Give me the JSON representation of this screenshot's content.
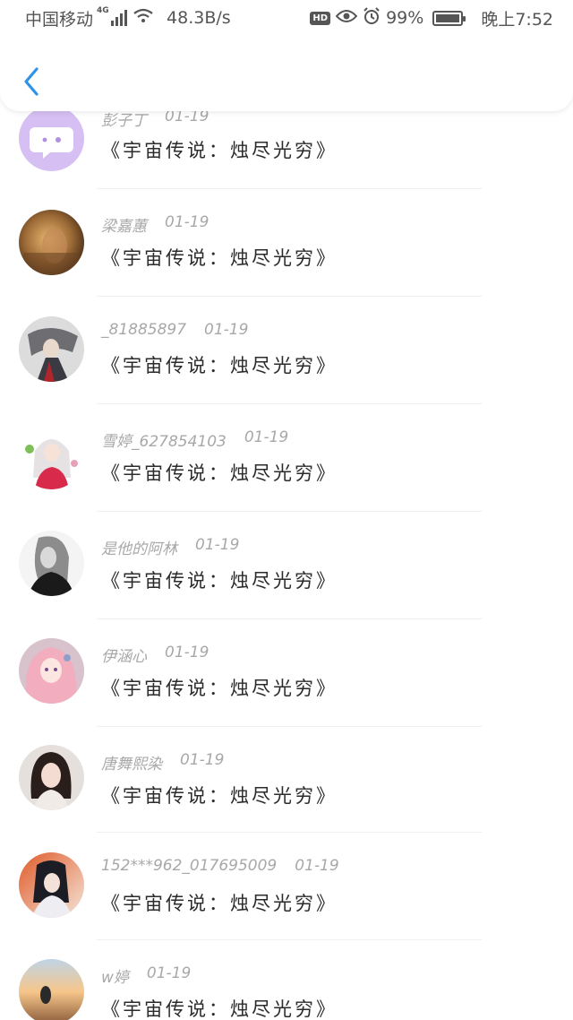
{
  "status_bar": {
    "carrier": "中国移动",
    "network": "4G",
    "speed": "48.3B/s",
    "hd": "HD",
    "battery": "99%",
    "battery_level": 0.99,
    "time": "晚上7:52"
  },
  "header": {
    "back_icon": "chevron-left-icon",
    "accent": "#2e93e8"
  },
  "items": [
    {
      "name": "彭子丁",
      "date": "01-19",
      "title": "《宇宙传说：烛尽光穷》",
      "avatar": "chat-bubble-default"
    },
    {
      "name": "梁嘉蕙",
      "date": "01-19",
      "title": "《宇宙传说：烛尽光穷》",
      "avatar": "warm-painting"
    },
    {
      "name": "_81885897",
      "date": "01-19",
      "title": "《宇宙传说：烛尽光穷》",
      "avatar": "ink-warrior"
    },
    {
      "name": "雪婷_627854103",
      "date": "01-19",
      "title": "《宇宙传说：烛尽光穷》",
      "avatar": "anime-girl-white-hair"
    },
    {
      "name": "是他的阿林",
      "date": "01-19",
      "title": "《宇宙传说：烛尽光穷》",
      "avatar": "grayscale-portrait"
    },
    {
      "name": "伊涵心",
      "date": "01-19",
      "title": "《宇宙传说：烛尽光穷》",
      "avatar": "anime-girl-pink-hair"
    },
    {
      "name": "唐舞熙染",
      "date": "01-19",
      "title": "《宇宙传说：烛尽光穷》",
      "avatar": "girl-selfie"
    },
    {
      "name": "152***962_017695009",
      "date": "01-19",
      "title": "《宇宙传说：烛尽光穷》",
      "avatar": "anime-swordsman"
    },
    {
      "name": "w婷",
      "date": "01-19",
      "title": "《宇宙传说：烛尽光穷》",
      "avatar": "sunset-beach"
    }
  ]
}
